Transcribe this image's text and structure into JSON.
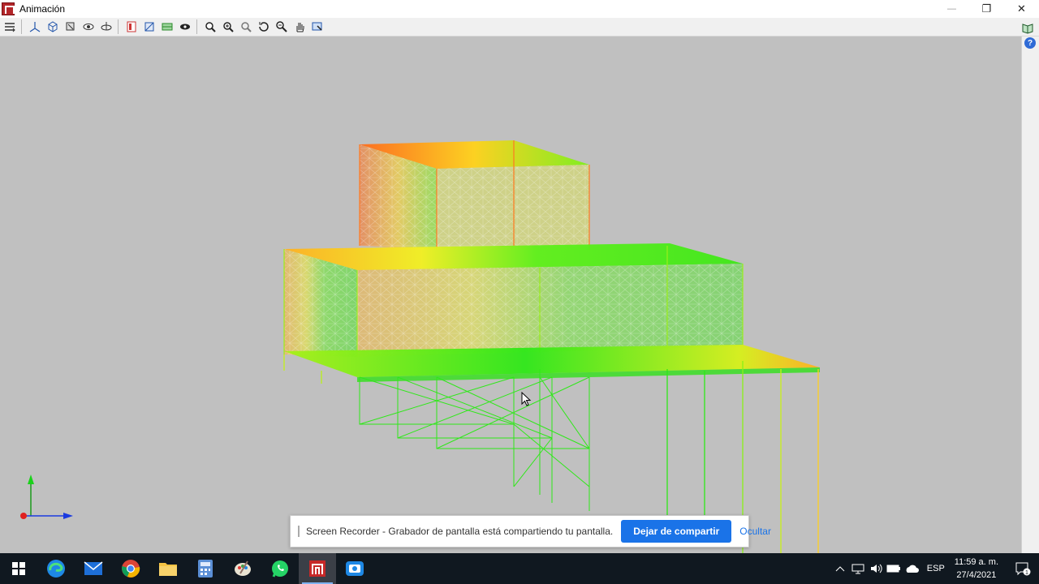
{
  "window": {
    "title": "Animación",
    "controls": {
      "minimize": "—",
      "restore": "❐",
      "close": "✕"
    }
  },
  "toolbar": {
    "buttons": [
      "layers-icon",
      "axes-icon",
      "cube-view-icon",
      "view-3d-icon",
      "eye-rotate-icon",
      "orbit-icon",
      "color-map-icon",
      "mesh-view-icon",
      "grid-view-icon",
      "visibility-icon",
      "zoom-window-icon",
      "zoom-extents-icon",
      "zoom-previous-icon",
      "rotate-icon",
      "zoom-icon",
      "pan-icon",
      "select-window-icon"
    ],
    "right": [
      "book-icon",
      "help-icon"
    ]
  },
  "help_icon_text": "?",
  "notification": {
    "message": "Screen Recorder - Grabador de pantalla está compartiendo tu pantalla.",
    "stop_button": "Dejar de compartir",
    "hide_link": "Ocultar"
  },
  "taskbar": {
    "apps": [
      {
        "name": "start-icon"
      },
      {
        "name": "edge-icon"
      },
      {
        "name": "mail-icon"
      },
      {
        "name": "chrome-icon"
      },
      {
        "name": "explorer-icon"
      },
      {
        "name": "calculator-icon"
      },
      {
        "name": "paint-icon"
      },
      {
        "name": "whatsapp-icon"
      },
      {
        "name": "cypecad-icon",
        "active": true
      },
      {
        "name": "screen-recorder-icon"
      }
    ],
    "tray": {
      "language": "ESP",
      "time": "11:59 a. m.",
      "date": "27/4/2021",
      "notification_count": "1"
    }
  },
  "colors": {
    "viewport_bg": "#c0c0c0",
    "accent": "#1a73e8",
    "taskbar": "#101820"
  }
}
